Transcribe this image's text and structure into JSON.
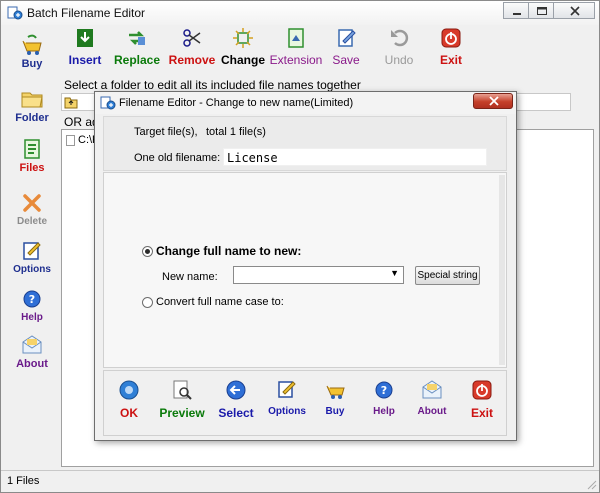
{
  "window": {
    "title": "Batch Filename Editor"
  },
  "sidebar": {
    "items": [
      {
        "label": "Buy",
        "icon": "buy-icon",
        "color": "#1f2f8f"
      },
      {
        "label": "Folder",
        "icon": "folder-icon",
        "color": "#1f2f8f"
      },
      {
        "label": "Files",
        "icon": "files-icon",
        "color": "#cc1111"
      },
      {
        "label": "Delete",
        "icon": "delete-icon",
        "color": "#8c8c8c"
      },
      {
        "label": "Options",
        "icon": "options-icon",
        "color": "#1f2f8f"
      },
      {
        "label": "Help",
        "icon": "help-icon",
        "color": "#6a1a8a"
      },
      {
        "label": "About",
        "icon": "about-icon",
        "color": "#6a1a8a"
      }
    ]
  },
  "toolbar": {
    "items": [
      {
        "label": "Insert",
        "color": "#1a1aaa"
      },
      {
        "label": "Replace",
        "color": "#0a7a0a"
      },
      {
        "label": "Remove",
        "color": "#cc1111"
      },
      {
        "label": "Change",
        "color": "#000000"
      },
      {
        "label": "Extension",
        "color": "#8a1a8a"
      },
      {
        "label": "Save",
        "color": "#8a1a8a"
      },
      {
        "label": "Undo",
        "color": "#9a9a9a"
      },
      {
        "label": "Exit",
        "color": "#cc1111"
      }
    ]
  },
  "main": {
    "hint": "Select a folder to edit all its included file names together",
    "or_add": "OR ad",
    "file_row": "C:\\P"
  },
  "status": {
    "text": "1 Files"
  },
  "dialog": {
    "title": "Filename Editor - Change to new name(Limited)",
    "target_label": "Target file(s),",
    "target_count": "total 1 file(s)",
    "old_filename_label": "One old filename:",
    "old_filename_value": "License",
    "option_full_name": "Change full name to new:",
    "new_name_label": "New name:",
    "new_name_value": "",
    "special_string": "Special string",
    "option_case": "Convert full name case to:",
    "buttons": [
      {
        "label": "OK",
        "color": "#cc1111"
      },
      {
        "label": "Preview",
        "color": "#0a7a0a"
      },
      {
        "label": "Select",
        "color": "#1a1aaa"
      },
      {
        "label": "Options",
        "color": "#1a1aaa"
      },
      {
        "label": "Buy",
        "color": "#1a1aaa"
      },
      {
        "label": "Help",
        "color": "#6a1a8a"
      },
      {
        "label": "About",
        "color": "#6a1a8a"
      },
      {
        "label": "Exit",
        "color": "#cc1111"
      }
    ]
  }
}
